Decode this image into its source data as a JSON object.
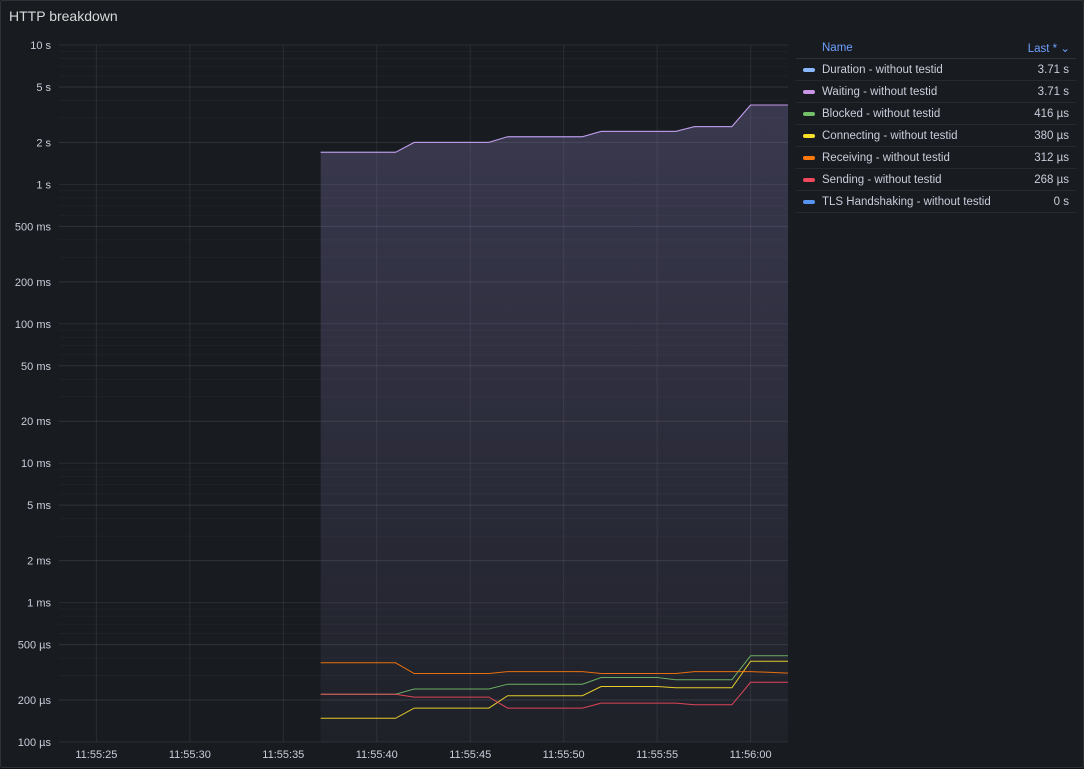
{
  "panel": {
    "title": "HTTP breakdown"
  },
  "legend": {
    "name_header": "Name",
    "last_header": "Last * ⌄",
    "items": [
      {
        "name": "Duration - without testid",
        "value": "3.71 s",
        "color": "#8ab8ff"
      },
      {
        "name": "Waiting - without testid",
        "value": "3.71 s",
        "color": "#ca95e5"
      },
      {
        "name": "Blocked - without testid",
        "value": "416 µs",
        "color": "#73bf69"
      },
      {
        "name": "Connecting - without testid",
        "value": "380 µs",
        "color": "#fade2a"
      },
      {
        "name": "Receiving - without testid",
        "value": "312 µs",
        "color": "#ff780a"
      },
      {
        "name": "Sending - without testid",
        "value": "268 µs",
        "color": "#f2495c"
      },
      {
        "name": "TLS Handshaking - without testid",
        "value": "0 s",
        "color": "#5794f2"
      }
    ]
  },
  "chart_data": {
    "type": "line",
    "title": "HTTP breakdown",
    "y_scale": "log",
    "y_unit": "seconds",
    "ylim": [
      0.0001,
      10
    ],
    "y_ticks": [
      {
        "v": 10,
        "label": "10 s"
      },
      {
        "v": 5,
        "label": "5 s"
      },
      {
        "v": 2,
        "label": "2 s"
      },
      {
        "v": 1,
        "label": "1 s"
      },
      {
        "v": 0.5,
        "label": "500 ms"
      },
      {
        "v": 0.2,
        "label": "200 ms"
      },
      {
        "v": 0.1,
        "label": "100 ms"
      },
      {
        "v": 0.05,
        "label": "50 ms"
      },
      {
        "v": 0.02,
        "label": "20 ms"
      },
      {
        "v": 0.01,
        "label": "10 ms"
      },
      {
        "v": 0.005,
        "label": "5 ms"
      },
      {
        "v": 0.002,
        "label": "2 ms"
      },
      {
        "v": 0.001,
        "label": "1 ms"
      },
      {
        "v": 0.0005,
        "label": "500 µs"
      },
      {
        "v": 0.0002,
        "label": "200 µs"
      },
      {
        "v": 0.0001,
        "label": "100 µs"
      }
    ],
    "x_ticks": [
      "11:55:25",
      "11:55:30",
      "11:55:35",
      "11:55:40",
      "11:55:45",
      "11:55:50",
      "11:55:55",
      "11:56:00"
    ],
    "xlim": [
      "11:55:23",
      "11:56:02"
    ],
    "grid": true,
    "legend_position": "right",
    "series": [
      {
        "name": "Duration - without testid",
        "color": "#8ab8ff",
        "fill": true,
        "points": [
          [
            "11:55:37",
            1.7
          ],
          [
            "11:55:41",
            1.7
          ],
          [
            "11:55:42",
            2.0
          ],
          [
            "11:55:46",
            2.0
          ],
          [
            "11:55:47",
            2.2
          ],
          [
            "11:55:51",
            2.2
          ],
          [
            "11:55:52",
            2.4
          ],
          [
            "11:55:56",
            2.4
          ],
          [
            "11:55:57",
            2.6
          ],
          [
            "11:55:59",
            2.6
          ],
          [
            "11:56:00",
            3.71
          ],
          [
            "11:56:02",
            3.71
          ]
        ]
      },
      {
        "name": "Waiting - without testid",
        "color": "#ca95e5",
        "fill": true,
        "points": [
          [
            "11:55:37",
            1.7
          ],
          [
            "11:55:41",
            1.7
          ],
          [
            "11:55:42",
            2.0
          ],
          [
            "11:55:46",
            2.0
          ],
          [
            "11:55:47",
            2.2
          ],
          [
            "11:55:51",
            2.2
          ],
          [
            "11:55:52",
            2.4
          ],
          [
            "11:55:56",
            2.4
          ],
          [
            "11:55:57",
            2.6
          ],
          [
            "11:55:59",
            2.6
          ],
          [
            "11:56:00",
            3.71
          ],
          [
            "11:56:02",
            3.71
          ]
        ]
      },
      {
        "name": "Blocked - without testid",
        "color": "#73bf69",
        "fill": false,
        "points": [
          [
            "11:55:37",
            0.00022
          ],
          [
            "11:55:41",
            0.00022
          ],
          [
            "11:55:42",
            0.00024
          ],
          [
            "11:55:46",
            0.00024
          ],
          [
            "11:55:47",
            0.00026
          ],
          [
            "11:55:51",
            0.00026
          ],
          [
            "11:55:52",
            0.00029
          ],
          [
            "11:55:55",
            0.00029
          ],
          [
            "11:55:56",
            0.00028
          ],
          [
            "11:55:59",
            0.00028
          ],
          [
            "11:56:00",
            0.000416
          ],
          [
            "11:56:02",
            0.000416
          ]
        ]
      },
      {
        "name": "Connecting - without testid",
        "color": "#fade2a",
        "fill": false,
        "points": [
          [
            "11:55:37",
            0.000148
          ],
          [
            "11:55:41",
            0.000148
          ],
          [
            "11:55:42",
            0.000175
          ],
          [
            "11:55:46",
            0.000175
          ],
          [
            "11:55:47",
            0.000215
          ],
          [
            "11:55:51",
            0.000215
          ],
          [
            "11:55:52",
            0.00025
          ],
          [
            "11:55:55",
            0.00025
          ],
          [
            "11:55:56",
            0.000245
          ],
          [
            "11:55:59",
            0.000245
          ],
          [
            "11:56:00",
            0.00038
          ],
          [
            "11:56:02",
            0.00038
          ]
        ]
      },
      {
        "name": "Receiving - without testid",
        "color": "#ff780a",
        "fill": false,
        "points": [
          [
            "11:55:37",
            0.00037
          ],
          [
            "11:55:41",
            0.00037
          ],
          [
            "11:55:42",
            0.00031
          ],
          [
            "11:55:46",
            0.00031
          ],
          [
            "11:55:47",
            0.00032
          ],
          [
            "11:55:51",
            0.00032
          ],
          [
            "11:55:52",
            0.00031
          ],
          [
            "11:55:56",
            0.00031
          ],
          [
            "11:55:57",
            0.00032
          ],
          [
            "11:56:00",
            0.00032
          ],
          [
            "11:56:02",
            0.000312
          ]
        ]
      },
      {
        "name": "Sending - without testid",
        "color": "#f2495c",
        "fill": false,
        "points": [
          [
            "11:55:37",
            0.00022
          ],
          [
            "11:55:41",
            0.00022
          ],
          [
            "11:55:42",
            0.00021
          ],
          [
            "11:55:46",
            0.00021
          ],
          [
            "11:55:47",
            0.000175
          ],
          [
            "11:55:51",
            0.000175
          ],
          [
            "11:55:52",
            0.00019
          ],
          [
            "11:55:56",
            0.00019
          ],
          [
            "11:55:57",
            0.000185
          ],
          [
            "11:55:59",
            0.000185
          ],
          [
            "11:56:00",
            0.000268
          ],
          [
            "11:56:02",
            0.000268
          ]
        ]
      },
      {
        "name": "TLS Handshaking - without testid",
        "color": "#5794f2",
        "fill": false,
        "points": []
      }
    ]
  }
}
